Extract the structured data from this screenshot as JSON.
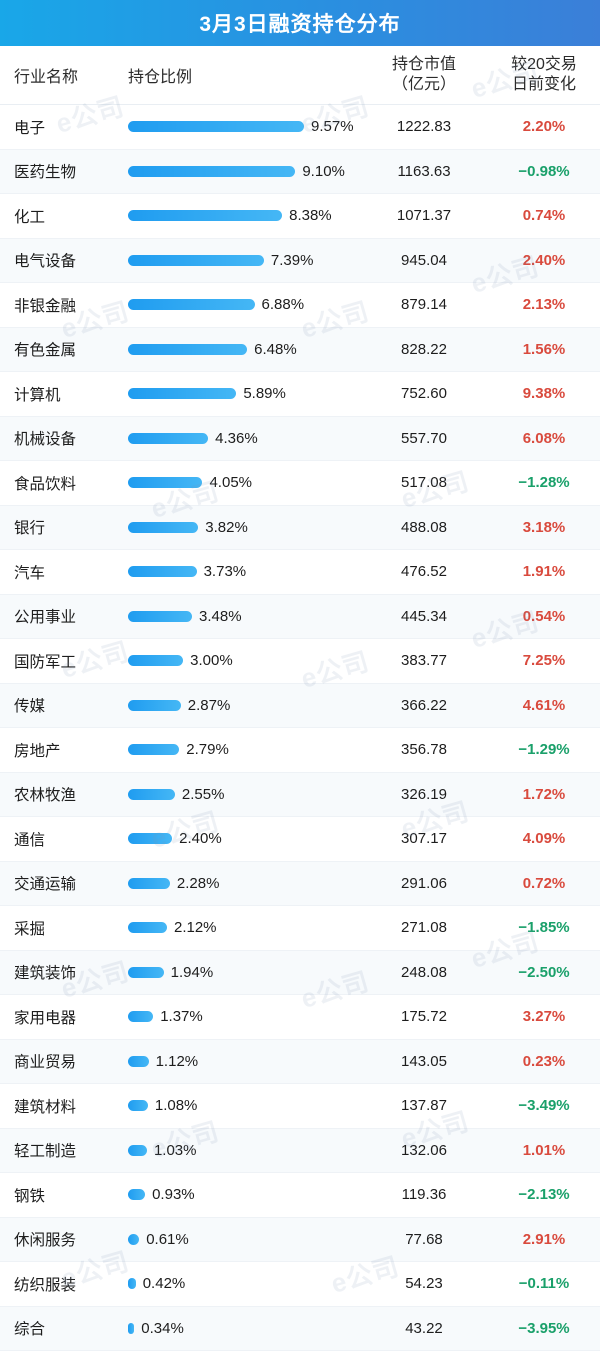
{
  "header": {
    "title": "3月3日融资持仓分布"
  },
  "columns": {
    "name": "行业名称",
    "ratio": "持仓比例",
    "value_line1": "持仓市值",
    "value_line2": "（亿元）",
    "change_line1": "较20交易",
    "change_line2": "日前变化"
  },
  "watermark": {
    "text": "e公司"
  },
  "chart_data": {
    "type": "bar",
    "title": "3月3日融资持仓分布",
    "xlabel": "持仓比例",
    "ylabel": "行业名称",
    "categories": [
      "电子",
      "医药生物",
      "化工",
      "电气设备",
      "非银金融",
      "有色金属",
      "计算机",
      "机械设备",
      "食品饮料",
      "银行",
      "汽车",
      "公用事业",
      "国防军工",
      "传媒",
      "房地产",
      "农林牧渔",
      "通信",
      "交通运输",
      "采掘",
      "建筑装饰",
      "家用电器",
      "商业贸易",
      "建筑材料",
      "轻工制造",
      "钢铁",
      "休闲服务",
      "纺织服装",
      "综合"
    ],
    "values": [
      9.57,
      9.1,
      8.38,
      7.39,
      6.88,
      6.48,
      5.89,
      4.36,
      4.05,
      3.82,
      3.73,
      3.48,
      3.0,
      2.87,
      2.79,
      2.55,
      2.4,
      2.28,
      2.12,
      1.94,
      1.37,
      1.12,
      1.08,
      1.03,
      0.93,
      0.61,
      0.42,
      0.34
    ],
    "xlim": [
      0,
      9.57
    ],
    "grid": false,
    "legend": "none",
    "series": [
      {
        "name": "持仓比例",
        "unit": "%",
        "values": [
          9.57,
          9.1,
          8.38,
          7.39,
          6.88,
          6.48,
          5.89,
          4.36,
          4.05,
          3.82,
          3.73,
          3.48,
          3.0,
          2.87,
          2.79,
          2.55,
          2.4,
          2.28,
          2.12,
          1.94,
          1.37,
          1.12,
          1.08,
          1.03,
          0.93,
          0.61,
          0.42,
          0.34
        ]
      },
      {
        "name": "持仓市值（亿元）",
        "values": [
          1222.83,
          1163.63,
          1071.37,
          945.04,
          879.14,
          828.22,
          752.6,
          557.7,
          517.08,
          488.08,
          476.52,
          445.34,
          383.77,
          366.22,
          356.78,
          326.19,
          307.17,
          291.06,
          271.08,
          248.08,
          175.72,
          143.05,
          137.87,
          132.06,
          119.36,
          77.68,
          54.23,
          43.22
        ]
      },
      {
        "name": "较20交易日前变化",
        "unit": "%",
        "values": [
          2.2,
          -0.98,
          0.74,
          2.4,
          2.13,
          1.56,
          9.38,
          6.08,
          -1.28,
          3.18,
          1.91,
          0.54,
          7.25,
          4.61,
          -1.29,
          1.72,
          4.09,
          0.72,
          -1.85,
          -2.5,
          3.27,
          0.23,
          -3.49,
          1.01,
          -2.13,
          2.91,
          -0.11,
          -3.95
        ]
      }
    ]
  },
  "rows": [
    {
      "name": "电子",
      "ratio": "9.57%",
      "ratio_num": 9.57,
      "value": "1222.83",
      "change": "2.20%",
      "dir": "up"
    },
    {
      "name": "医药生物",
      "ratio": "9.10%",
      "ratio_num": 9.1,
      "value": "1163.63",
      "change": "−0.98%",
      "dir": "down"
    },
    {
      "name": "化工",
      "ratio": "8.38%",
      "ratio_num": 8.38,
      "value": "1071.37",
      "change": "0.74%",
      "dir": "up"
    },
    {
      "name": "电气设备",
      "ratio": "7.39%",
      "ratio_num": 7.39,
      "value": "945.04",
      "change": "2.40%",
      "dir": "up"
    },
    {
      "name": "非银金融",
      "ratio": "6.88%",
      "ratio_num": 6.88,
      "value": "879.14",
      "change": "2.13%",
      "dir": "up"
    },
    {
      "name": "有色金属",
      "ratio": "6.48%",
      "ratio_num": 6.48,
      "value": "828.22",
      "change": "1.56%",
      "dir": "up"
    },
    {
      "name": "计算机",
      "ratio": "5.89%",
      "ratio_num": 5.89,
      "value": "752.60",
      "change": "9.38%",
      "dir": "up"
    },
    {
      "name": "机械设备",
      "ratio": "4.36%",
      "ratio_num": 4.36,
      "value": "557.70",
      "change": "6.08%",
      "dir": "up"
    },
    {
      "name": "食品饮料",
      "ratio": "4.05%",
      "ratio_num": 4.05,
      "value": "517.08",
      "change": "−1.28%",
      "dir": "down"
    },
    {
      "name": "银行",
      "ratio": "3.82%",
      "ratio_num": 3.82,
      "value": "488.08",
      "change": "3.18%",
      "dir": "up"
    },
    {
      "name": "汽车",
      "ratio": "3.73%",
      "ratio_num": 3.73,
      "value": "476.52",
      "change": "1.91%",
      "dir": "up"
    },
    {
      "name": "公用事业",
      "ratio": "3.48%",
      "ratio_num": 3.48,
      "value": "445.34",
      "change": "0.54%",
      "dir": "up"
    },
    {
      "name": "国防军工",
      "ratio": "3.00%",
      "ratio_num": 3.0,
      "value": "383.77",
      "change": "7.25%",
      "dir": "up"
    },
    {
      "name": "传媒",
      "ratio": "2.87%",
      "ratio_num": 2.87,
      "value": "366.22",
      "change": "4.61%",
      "dir": "up"
    },
    {
      "name": "房地产",
      "ratio": "2.79%",
      "ratio_num": 2.79,
      "value": "356.78",
      "change": "−1.29%",
      "dir": "down"
    },
    {
      "name": "农林牧渔",
      "ratio": "2.55%",
      "ratio_num": 2.55,
      "value": "326.19",
      "change": "1.72%",
      "dir": "up"
    },
    {
      "name": "通信",
      "ratio": "2.40%",
      "ratio_num": 2.4,
      "value": "307.17",
      "change": "4.09%",
      "dir": "up"
    },
    {
      "name": "交通运输",
      "ratio": "2.28%",
      "ratio_num": 2.28,
      "value": "291.06",
      "change": "0.72%",
      "dir": "up"
    },
    {
      "name": "采掘",
      "ratio": "2.12%",
      "ratio_num": 2.12,
      "value": "271.08",
      "change": "−1.85%",
      "dir": "down"
    },
    {
      "name": "建筑装饰",
      "ratio": "1.94%",
      "ratio_num": 1.94,
      "value": "248.08",
      "change": "−2.50%",
      "dir": "down"
    },
    {
      "name": "家用电器",
      "ratio": "1.37%",
      "ratio_num": 1.37,
      "value": "175.72",
      "change": "3.27%",
      "dir": "up"
    },
    {
      "name": "商业贸易",
      "ratio": "1.12%",
      "ratio_num": 1.12,
      "value": "143.05",
      "change": "0.23%",
      "dir": "up"
    },
    {
      "name": "建筑材料",
      "ratio": "1.08%",
      "ratio_num": 1.08,
      "value": "137.87",
      "change": "−3.49%",
      "dir": "down"
    },
    {
      "name": "轻工制造",
      "ratio": "1.03%",
      "ratio_num": 1.03,
      "value": "132.06",
      "change": "1.01%",
      "dir": "up"
    },
    {
      "name": "钢铁",
      "ratio": "0.93%",
      "ratio_num": 0.93,
      "value": "119.36",
      "change": "−2.13%",
      "dir": "down"
    },
    {
      "name": "休闲服务",
      "ratio": "0.61%",
      "ratio_num": 0.61,
      "value": "77.68",
      "change": "2.91%",
      "dir": "up"
    },
    {
      "name": "纺织服装",
      "ratio": "0.42%",
      "ratio_num": 0.42,
      "value": "54.23",
      "change": "−0.11%",
      "dir": "down"
    },
    {
      "name": "综合",
      "ratio": "0.34%",
      "ratio_num": 0.34,
      "value": "43.22",
      "change": "−3.95%",
      "dir": "down"
    }
  ]
}
